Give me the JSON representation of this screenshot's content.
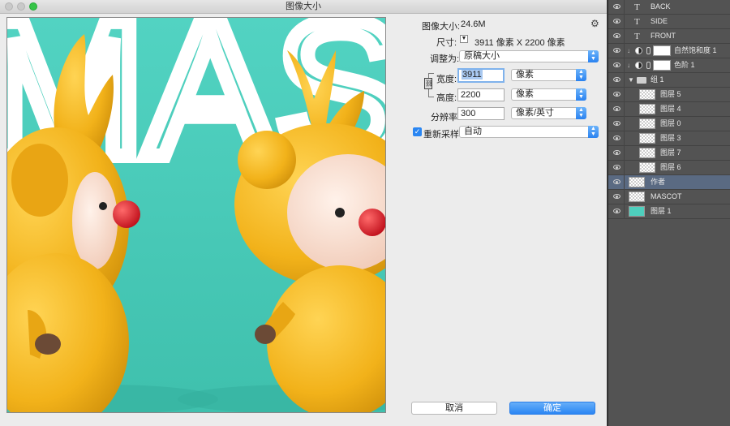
{
  "dialog": {
    "title": "图像大小",
    "image_size_label": "图像大小:",
    "image_size_value": "24.6M",
    "dimensions_label": "尺寸:",
    "dimensions_value": "3911 像素  X  2200 像素",
    "fit_to_label": "调整为:",
    "fit_to_value": "原稿大小",
    "width_label": "宽度:",
    "width_value": "3911",
    "width_unit": "像素",
    "height_label": "高度:",
    "height_value": "2200",
    "height_unit": "像素",
    "resolution_label": "分辨率:",
    "resolution_value": "300",
    "resolution_unit": "像素/英寸",
    "resample_label": "重新采样:",
    "resample_checked": true,
    "resample_value": "自动",
    "cancel_label": "取消",
    "ok_label": "确定",
    "preview_text": "MAS",
    "colors": {
      "preview_bg": "#4ecfbd",
      "mascot": "#f2b21a",
      "nose": "#e01e2a",
      "ok_button": "#2b86f3"
    }
  },
  "layers": [
    {
      "name": "BACK",
      "type": "text"
    },
    {
      "name": "SIDE",
      "type": "text"
    },
    {
      "name": "FRONT",
      "type": "text"
    },
    {
      "name": "自然饱和度 1",
      "type": "adjustment"
    },
    {
      "name": "色阶 1",
      "type": "adjustment"
    },
    {
      "name": "组 1",
      "type": "group"
    },
    {
      "name": "图层 5",
      "type": "image"
    },
    {
      "name": "图层 4",
      "type": "image"
    },
    {
      "name": "图层 0",
      "type": "image"
    },
    {
      "name": "图层 3",
      "type": "image"
    },
    {
      "name": "图层 7",
      "type": "image"
    },
    {
      "name": "图层 6",
      "type": "image"
    },
    {
      "name": "作者",
      "type": "image",
      "active": true
    },
    {
      "name": "MASCOT",
      "type": "image"
    },
    {
      "name": "图层 1",
      "type": "fill"
    }
  ]
}
